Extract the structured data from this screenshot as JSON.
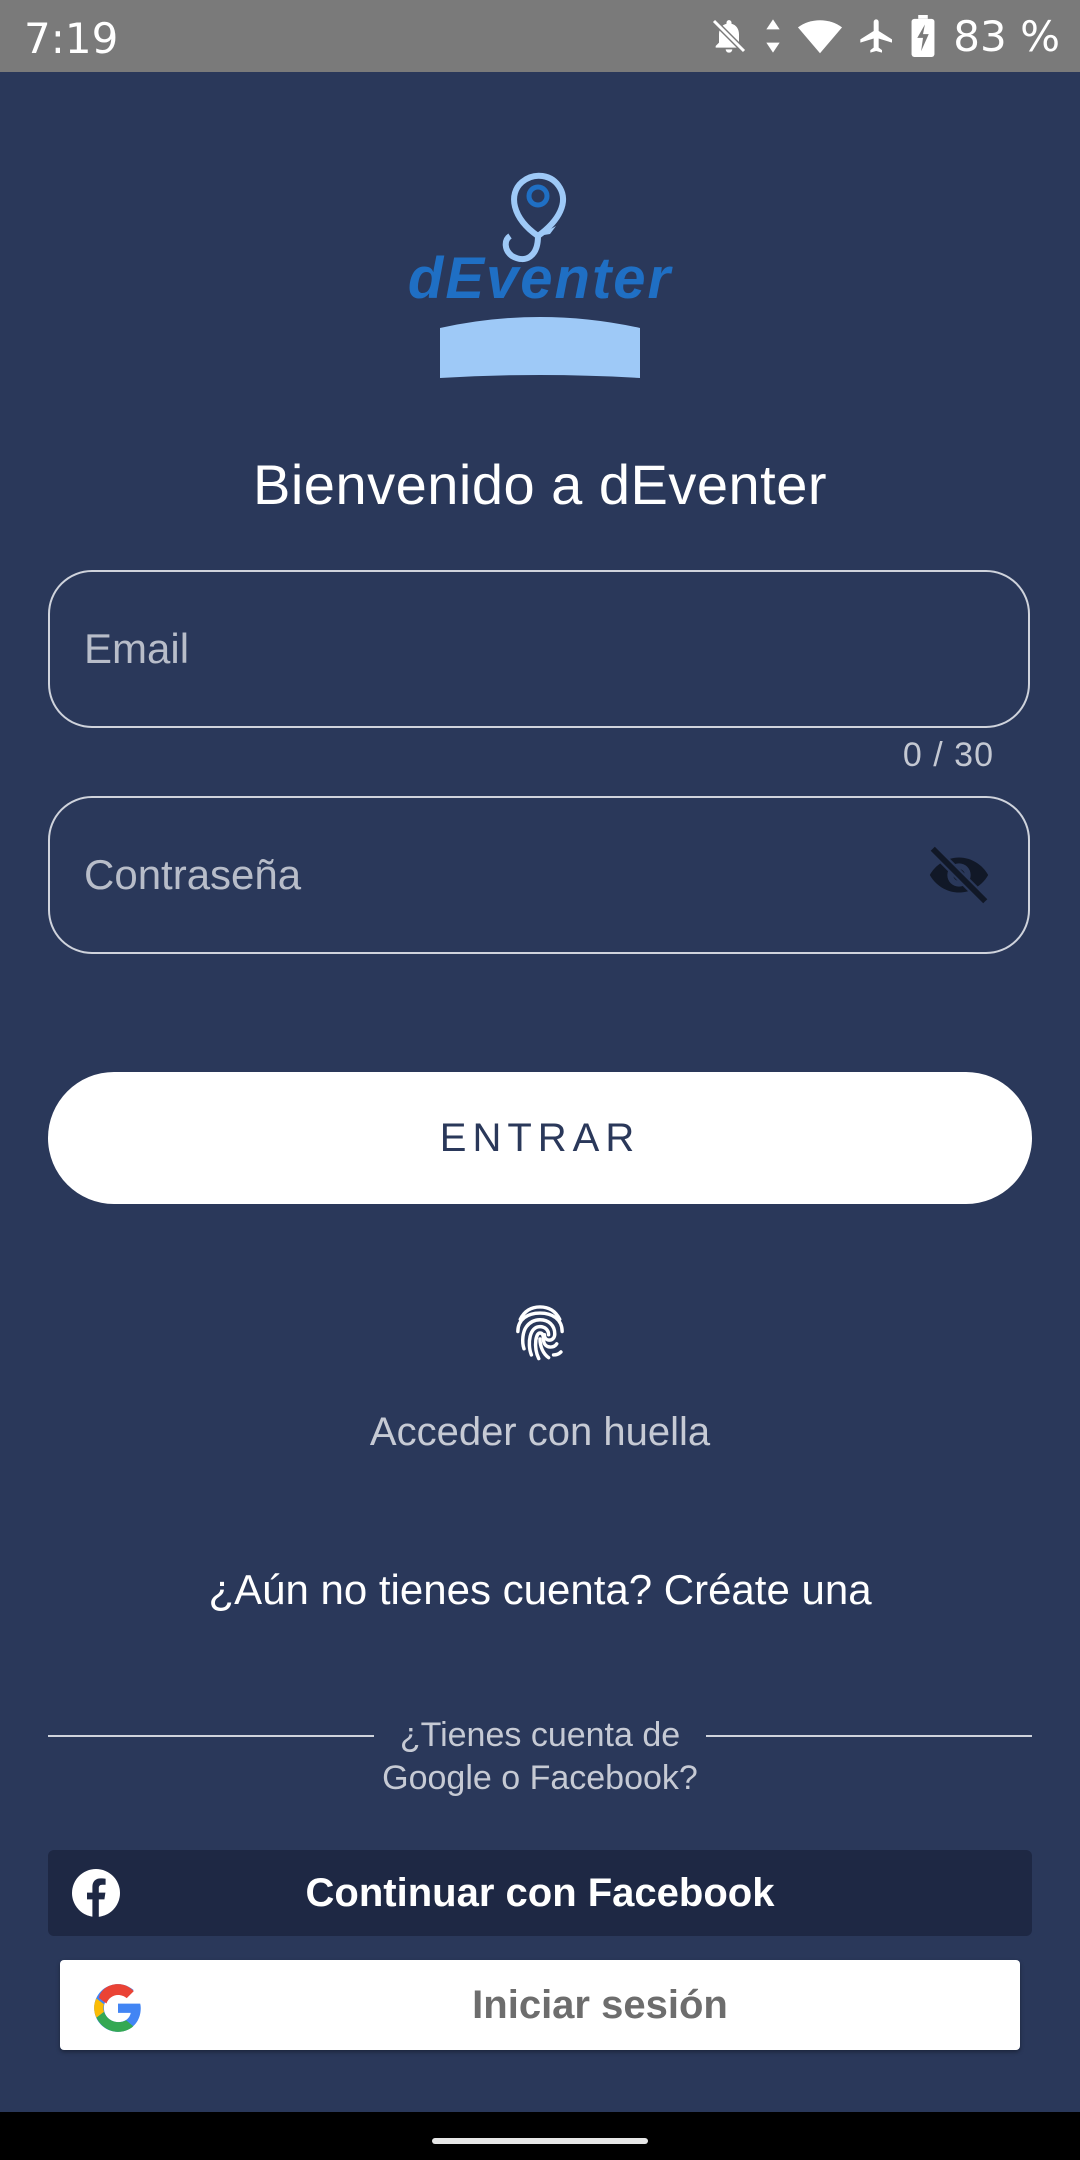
{
  "status_bar": {
    "time": "7:19",
    "battery": "83 %",
    "icons": [
      "bell-off-icon",
      "data-arrows-icon",
      "wifi-icon",
      "airplane-icon",
      "battery-charging-icon"
    ]
  },
  "logo": {
    "text": "dEventer",
    "icon": "location-pin-icon"
  },
  "welcome": "Bienvenido a dEventer",
  "email": {
    "placeholder": "Email",
    "counter": "0 / 30"
  },
  "password": {
    "placeholder": "Contraseña",
    "toggle_icon": "eye-off-icon"
  },
  "enter_button": "ENTRAR",
  "fingerprint": {
    "icon": "fingerprint-icon",
    "label": "Acceder con huella"
  },
  "signup_link": "¿Aún no tienes cuenta? Créate una",
  "social_divider": {
    "line1": "¿Tienes cuenta de",
    "line2": "Google o Facebook?"
  },
  "facebook_button": {
    "label": "Continuar con Facebook",
    "icon": "facebook-icon"
  },
  "google_button": {
    "label": "Iniciar sesión",
    "icon": "google-icon"
  },
  "colors": {
    "background": "#2a385a",
    "facebook_button": "#1e2844",
    "logo_blue": "#1f6fc4",
    "logo_light_blue": "#9ec9f7"
  }
}
